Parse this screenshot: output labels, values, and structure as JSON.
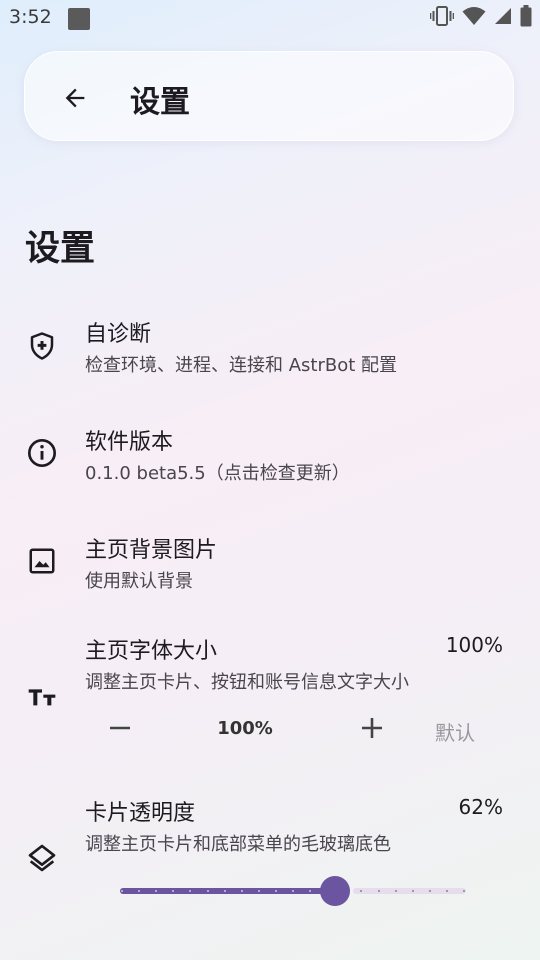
{
  "status_bar": {
    "time": "3:52"
  },
  "app_bar": {
    "title": "设置"
  },
  "section_title": "设置",
  "settings": [
    {
      "id": "self-diagnosis",
      "icon": "shield-plus-icon",
      "title": "自诊断",
      "subtitle": "检查环境、进程、连接和 AstrBot 配置"
    },
    {
      "id": "software-version",
      "icon": "info-icon",
      "title": "软件版本",
      "subtitle": "0.1.0 beta5.5（点击检查更新）"
    },
    {
      "id": "home-background",
      "icon": "image-icon",
      "title": "主页背景图片",
      "subtitle": "使用默认背景"
    },
    {
      "id": "home-font-size",
      "icon": "text-size-icon",
      "title": "主页字体大小",
      "subtitle": "调整主页卡片、按钮和账号信息文字大小",
      "value": "100%"
    },
    {
      "id": "card-opacity",
      "icon": "layers-icon",
      "title": "卡片透明度",
      "subtitle": "调整主页卡片和底部菜单的毛玻璃底色",
      "value": "62%"
    }
  ],
  "font_stepper": {
    "value": "100%",
    "default_label": "默认"
  },
  "opacity_slider": {
    "level": 0.62
  },
  "colors": {
    "accent": "#6b55a0",
    "accent_light": "#e5dcec"
  }
}
